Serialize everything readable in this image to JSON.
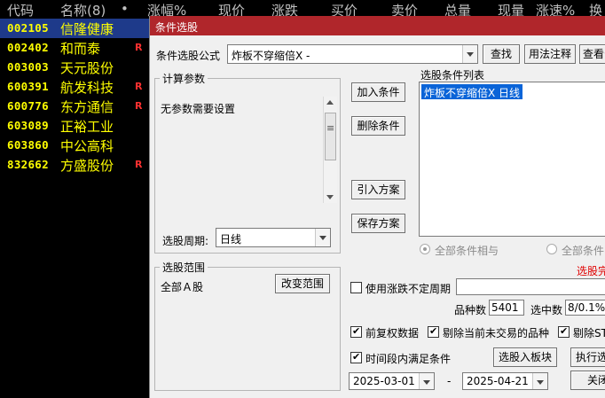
{
  "stock_list": {
    "headers": [
      "代码",
      "名称(8)",
      "•",
      "涨幅%",
      "现价",
      "涨跌",
      "买价",
      "卖价",
      "总量",
      "现量",
      "涨速%",
      "换"
    ],
    "rows": [
      {
        "code": "002105",
        "name": "信隆健康",
        "flag": ""
      },
      {
        "code": "002402",
        "name": "和而泰",
        "flag": "R"
      },
      {
        "code": "003003",
        "name": "天元股份",
        "flag": ""
      },
      {
        "code": "600391",
        "name": "航发科技",
        "flag": "R"
      },
      {
        "code": "600776",
        "name": "东方通信",
        "flag": "R"
      },
      {
        "code": "603089",
        "name": "正裕工业",
        "flag": ""
      },
      {
        "code": "603860",
        "name": "中公高科",
        "flag": ""
      },
      {
        "code": "832662",
        "name": "方盛股份",
        "flag": "R"
      }
    ]
  },
  "dialog": {
    "title": "条件选股",
    "formula_label": "条件选股公式",
    "formula_value": "炸板不穿缩倍X -",
    "find_button": "查找",
    "usage_button": "用法注释",
    "view_button": "查看公",
    "params_group": "计算参数",
    "params_text": "无参数需要设置",
    "period_label": "选股周期:",
    "period_value": "日线",
    "add_button": "加入条件",
    "delete_button": "删除条件",
    "import_button": "引入方案",
    "save_button": "保存方案",
    "conditions_label": "选股条件列表",
    "conditions": [
      "炸板不穿缩倍X  日线"
    ],
    "radio_and": "全部条件相与",
    "radio_or": "全部条件",
    "status_text": "选股完",
    "range_group": "选股范围",
    "range_text": "全部Ａ股",
    "change_range_button": "改变范围",
    "use_period_label": "使用涨跌不定周期",
    "count_label": "品种数",
    "count_value": "5401",
    "selected_label": "选中数",
    "selected_value": "8/0.1%",
    "opt_forward_adjust": "前复权数据",
    "opt_exclude_untraded": "剔除当前未交易的品种",
    "opt_exclude_st": "剔除ST",
    "opt_period_match": "时间段内满足条件",
    "to_sector_button": "选股入板块",
    "execute_button": "执行选",
    "close_button": "关闭",
    "date_from": "2025-03-01",
    "date_sep": "-",
    "date_to": "2025-04-21"
  },
  "colors": {
    "title_bar": "#b0262b",
    "stock_text": "#ffff00",
    "header_text": "#c0c0c0",
    "flag": "#ff3030",
    "selected_row": "#1e3a8a",
    "list_selection": "#0a64d8",
    "status_red": "#e00000"
  }
}
